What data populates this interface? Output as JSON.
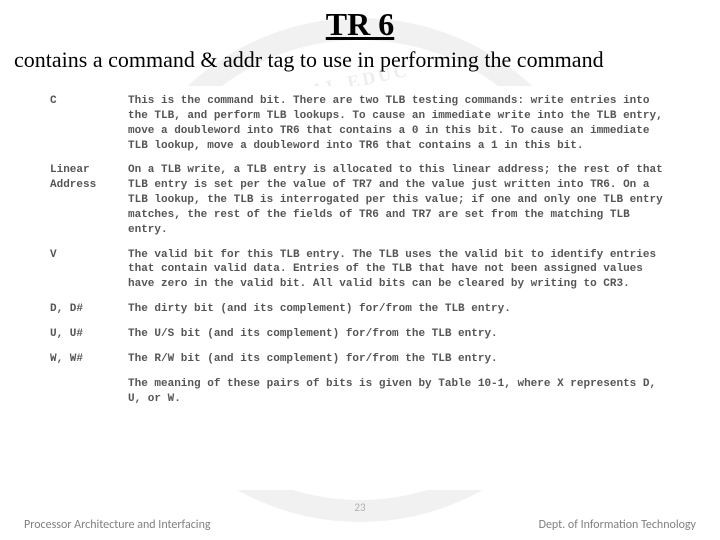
{
  "header": {
    "title": "TR 6",
    "subtitle": "contains a command & addr tag to use in performing the command"
  },
  "fields": [
    {
      "name": "C",
      "desc": "This is the command bit. There are two TLB testing commands: write entries into the TLB, and perform TLB lookups. To cause an immediate write into the TLB entry, move a doubleword into TR6 that contains a 0 in this bit. To cause an immediate TLB lookup, move a doubleword into TR6 that contains a 1 in this bit."
    },
    {
      "name": "Linear Address",
      "desc": "On a TLB write, a TLB entry is allocated to this linear address; the rest of that TLB entry is set per the value of TR7 and the value just written into TR6. On a TLB lookup, the TLB is interrogated per this value; if one and only one TLB entry matches, the rest of the fields of TR6 and TR7 are set from the matching TLB entry."
    },
    {
      "name": "V",
      "desc": "The valid bit for this TLB entry. The TLB uses the valid bit to identify entries that contain valid data. Entries of the TLB that have not been assigned values have zero in the valid bit. All valid bits can be cleared by writing to CR3."
    },
    {
      "name": "D, D#",
      "desc": "The dirty bit (and its complement) for/from the TLB entry."
    },
    {
      "name": "U, U#",
      "desc": "The U/S bit (and its complement) for/from the TLB entry."
    },
    {
      "name": "W, W#",
      "desc": "The R/W bit (and its complement) for/from the TLB entry."
    }
  ],
  "note": "The meaning of these pairs of bits is given by Table 10-1, where X represents D, U, or W.",
  "footer": {
    "left": "Processor Architecture and Interfacing",
    "page": "23",
    "right": "Dept. of Information Technology"
  }
}
